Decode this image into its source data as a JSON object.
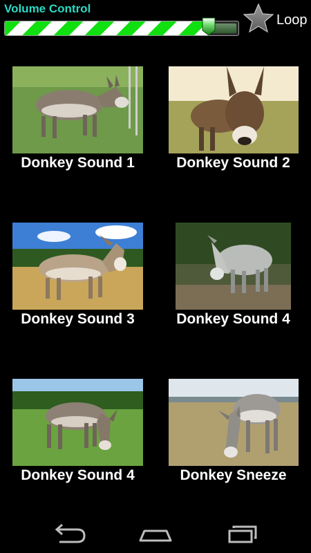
{
  "volume": {
    "title": "Volume Control",
    "level_percent": 87
  },
  "loop": {
    "label": "Loop",
    "icon": "star-icon"
  },
  "sounds": [
    {
      "label": "Donkey Sound 1"
    },
    {
      "label": "Donkey Sound 2"
    },
    {
      "label": "Donkey Sound 3"
    },
    {
      "label": "Donkey Sound 4"
    },
    {
      "label": "Donkey Sound 4"
    },
    {
      "label": "Donkey Sneeze"
    }
  ],
  "nav": {
    "back_icon": "back-icon",
    "home_icon": "home-icon",
    "recents_icon": "recent-apps-icon"
  },
  "colors": {
    "title": "#2bd9c4",
    "bar_green": "#10e010",
    "background": "#000000"
  }
}
